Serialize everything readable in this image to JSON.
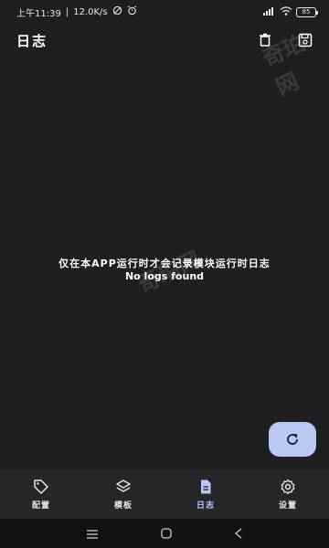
{
  "status_bar": {
    "time": "上午11:39",
    "speed": "12.0K/s",
    "battery": "85"
  },
  "app_bar": {
    "title": "日志"
  },
  "content": {
    "message_line1": "仅在本APP运行时才会记录模块运行时日志",
    "message_line2": "No logs found"
  },
  "bottom_nav": {
    "items": [
      {
        "label": "配置",
        "icon": "tag-icon"
      },
      {
        "label": "模板",
        "icon": "layers-icon"
      },
      {
        "label": "日志",
        "icon": "document-icon",
        "active": true
      },
      {
        "label": "设置",
        "icon": "gear-icon"
      }
    ]
  },
  "watermark": "奇珀网",
  "colors": {
    "background": "#1f1f21",
    "accent": "#b9c9f3",
    "nav_background": "#27272a"
  }
}
